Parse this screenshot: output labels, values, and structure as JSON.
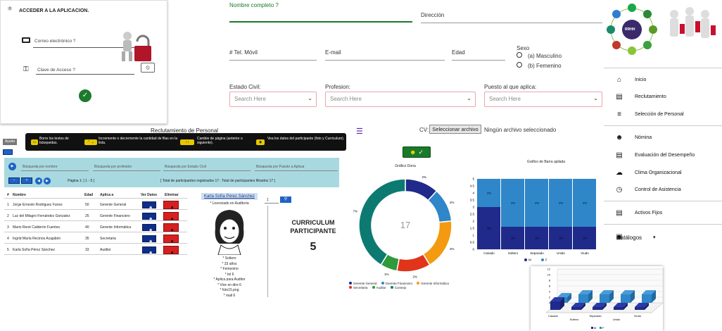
{
  "login": {
    "title": "ACCEDER A LA APLICACION.",
    "email_label": "Correo electrónico ?",
    "password_label": "Clave de Acceso ?"
  },
  "form": {
    "nombre_label": "Nombre completo ?",
    "direccion_label": "Dirección",
    "tel_label": "# Tel. Móvil",
    "email_label": "E-mail",
    "edad_label": "Edad",
    "sexo_label": "Sexo",
    "sexo_a": "(a) Masculino",
    "sexo_b": "(b) Femenino",
    "estado_civil_label": "Estado Civil:",
    "profesion_label": "Profesion:",
    "puesto_label": "Puesto al que aplica:",
    "search_placeholder": "Search Here",
    "cv_label": "CV:",
    "cv_button": "Seleccionar archivo",
    "cv_status": "Ningún archivo seleccionado"
  },
  "rrhh": {
    "center": "RRHH"
  },
  "nav": {
    "items": [
      {
        "label": "Inicio",
        "icon": "home-icon"
      },
      {
        "label": "Reclutamiento",
        "icon": "id-card-icon"
      },
      {
        "label": "Selección de Personal",
        "icon": "checklist-icon"
      },
      {
        "label": "Nómina",
        "icon": "users-icon"
      },
      {
        "label": "Evaluación del Desempeño",
        "icon": "clipboard-icon"
      },
      {
        "label": "Clima Organizacional",
        "icon": "cloud-icon"
      },
      {
        "label": "Control de Asistencia",
        "icon": "clock-icon"
      },
      {
        "label": "Activos Fijos",
        "icon": "book-icon"
      },
      {
        "label": "Catálogos",
        "icon": "briefcase-icon"
      }
    ]
  },
  "reclut": {
    "title": "Reclutamiento de Personal",
    "ayuda": "Ayuda",
    "tips": [
      "Borre los textos de búsquedas.",
      "Incremente o decremente la cantidad de filas en la lista.",
      "Cambie de página (anterior o siguiente).",
      "Vea los datos del participante (foto y Curriculum)."
    ],
    "search": [
      "Búsqueda por nombre",
      "Búsqueda por profesión",
      "Búsqueda por Estado Civil",
      "Búsqueda por Puesto a Aplicar"
    ],
    "pagina": "Página 1: [ 1 - 5 ]",
    "totals": "[ Total de participantes registrados 17 : Total de participantes filtrados 17 ]",
    "columns": [
      "#",
      "Nombre",
      "Edad",
      "Aplica a",
      "Ver Datos",
      "Eliminar"
    ],
    "rows": [
      {
        "n": "1",
        "nombre": "Jorge Ernesto Rodriguez Funes",
        "edad": "50",
        "aplica": "Gerente General"
      },
      {
        "n": "2",
        "nombre": "Luz del Milagro Fernández Gonzalez",
        "edad": "25",
        "aplica": "Gerente Financiero"
      },
      {
        "n": "3",
        "nombre": "Mario René Calderón Fuentes",
        "edad": "40",
        "aplica": "Gerente Informática"
      },
      {
        "n": "4",
        "nombre": "Ingrid María Recinos Acajabón",
        "edad": "35",
        "aplica": "Secretaria"
      },
      {
        "n": "5",
        "nombre": "Karla Sofía Pérez Sánchez",
        "edad": "33",
        "aplica": "Auditor"
      }
    ]
  },
  "participant": {
    "name": "Karla Sofía Pérez Sánchez",
    "subtitle": "* Licenciado en Auditoría",
    "details": [
      "* Soltero",
      "* 33 años",
      "* Femenino",
      "* tel 6",
      "* Aplica para Auditor",
      "* Vive en dire 6",
      "* foto15.png",
      "* mail 6"
    ],
    "page_value": "1",
    "curriculum_title": "CURRICULUM PARTICIPANTE",
    "count": "5"
  },
  "colors": {
    "navy": "#1f2a8a",
    "lightblue": "#2f86c8",
    "orange": "#f39a11",
    "red": "#e0341b",
    "green": "#2e9a3a",
    "teal": "#0d7a72",
    "accent": "#1a7a2a"
  },
  "chart_data": [
    {
      "type": "pie",
      "title": "Gráfico Dona",
      "center_label": "17",
      "categories": [
        "Gerente General",
        "Gerente Financiero",
        "Gerente Informática",
        "Secretaria",
        "Auditor",
        "Consejo"
      ],
      "values": [
        2,
        2,
        3,
        2,
        1,
        7
      ],
      "labels": [
        "2%",
        "2%",
        "3%",
        "2%",
        "1%",
        "7%"
      ],
      "colors": [
        "#1f2a8a",
        "#2f86c8",
        "#f39a11",
        "#e0341b",
        "#2e9a3a",
        "#0d7a72"
      ]
    },
    {
      "type": "bar",
      "title": "Gráfico de Barra apilada",
      "categories": [
        "Casado",
        "Soltero",
        "Separado",
        "Unido",
        "Viudo"
      ],
      "series": [
        {
          "name": "M",
          "values": [
            3,
            1.6,
            1.6,
            1.6,
            1.6
          ]
        },
        {
          "name": "F",
          "values": [
            2,
            3.4,
            3.4,
            3.4,
            3.4
          ]
        }
      ],
      "labels": [
        [
          "3%",
          "2%"
        ],
        [
          "1%",
          "3%"
        ],
        [
          "1%",
          "3%"
        ],
        [
          "1%",
          "3%"
        ],
        [
          "1%",
          "3%"
        ]
      ],
      "ylim": [
        0,
        5
      ],
      "yticks": [
        "0",
        "0.5",
        "1",
        "1.5",
        "2",
        "2.5",
        "3",
        "3.5",
        "4",
        "4.5",
        "5"
      ]
    },
    {
      "type": "bar",
      "categories": [
        "Casado",
        "Soltero",
        "Separado",
        "Unido",
        "Viudo"
      ],
      "series": [
        {
          "name": "M",
          "values": [
            3,
            1,
            1,
            1,
            1
          ]
        },
        {
          "name": "F",
          "values": [
            2,
            3,
            3,
            3,
            3
          ]
        }
      ],
      "ylim": [
        0,
        12
      ],
      "yticks": [
        "0",
        "2",
        "4",
        "6",
        "8",
        "10",
        "12"
      ]
    }
  ]
}
